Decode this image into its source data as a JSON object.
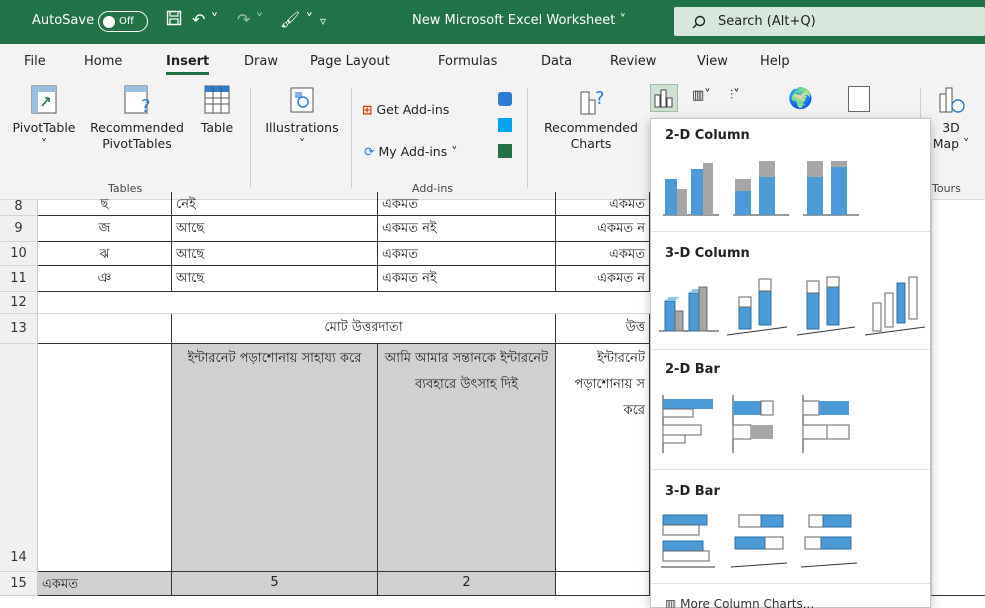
{
  "titlebar": {
    "autosave_label": "AutoSave",
    "autosave_state": "Off",
    "document_title": "New Microsoft Excel Worksheet",
    "search_placeholder": "Search (Alt+Q)"
  },
  "tabs": [
    "File",
    "Home",
    "Insert",
    "Draw",
    "Page Layout",
    "Formulas",
    "Data",
    "Review",
    "View",
    "Help"
  ],
  "active_tab": "Insert",
  "ribbon": {
    "pivottable": "PivotTable",
    "recommended_pivot_1": "Recommended",
    "recommended_pivot_2": "PivotTables",
    "table": "Table",
    "tables_group": "Tables",
    "illustrations": "Illustrations",
    "get_addins": "Get Add-ins",
    "my_addins": "My Add-ins",
    "addins_group": "Add-ins",
    "recommended_charts_1": "Recommended",
    "recommended_charts_2": "Charts",
    "map_3d_1": "3D",
    "map_3d_2": "Map",
    "tours_group": "Tours"
  },
  "rows": {
    "r8": {
      "num": "8",
      "a": "ছ",
      "b": "নেই",
      "c": "একমত",
      "d": "একমত"
    },
    "r9": {
      "num": "9",
      "a": "জ",
      "b": "আছে",
      "c": "একমত নই",
      "d": "একমত ন"
    },
    "r10": {
      "num": "10",
      "a": "ঝ",
      "b": "আছে",
      "c": "একমত",
      "d": "একমত"
    },
    "r11": {
      "num": "11",
      "a": "ঞ",
      "b": "আছে",
      "c": "একমত নই",
      "d": "একমত ন"
    },
    "r12": {
      "num": "12"
    },
    "r13": {
      "num": "13",
      "merged": "মোট উত্তরদাতা",
      "d": "উত্ত"
    },
    "r14": {
      "num": "14",
      "b": "ইন্টারনেট পড়াশোনায় সাহায্য করে",
      "c": "আমি আমার সন্তানকে ইন্টারনেট ব্যবহারে উৎসাহ দিই",
      "d": "ইন্টারনেট পড়াশোনায় স করে"
    },
    "r15": {
      "num": "15",
      "a": "একমত",
      "b": "5",
      "c": "2"
    }
  },
  "dropdown": {
    "col2d": "2-D Column",
    "col3d": "3-D Column",
    "bar2d": "2-D Bar",
    "bar3d": "3-D Bar",
    "more": "More Column Charts..."
  },
  "colors": {
    "excel_green": "#217346",
    "chart_blue": "#4a9bd8",
    "chart_gray": "#a6a6a6"
  }
}
